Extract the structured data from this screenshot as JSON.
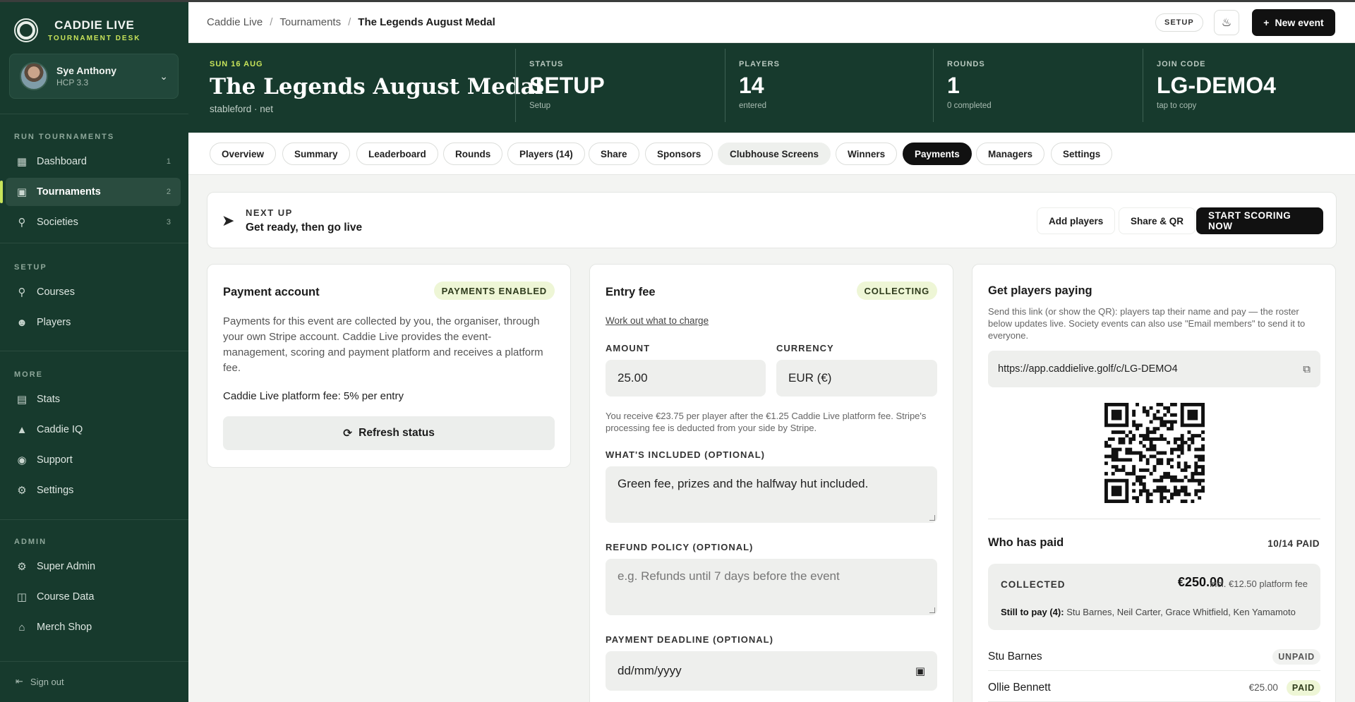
{
  "brand": {
    "name": "CADDIE LIVE",
    "tagline": "TOURNAMENT DESK"
  },
  "user": {
    "name": "Sye Anthony",
    "handicap": "HCP 3.3"
  },
  "sidebar": {
    "sections": [
      {
        "label": "RUN TOURNAMENTS",
        "items": [
          {
            "label": "Dashboard",
            "icon": "grid-icon",
            "count": "1"
          },
          {
            "label": "Tournaments",
            "icon": "calendar-icon",
            "count": "2",
            "active": true
          },
          {
            "label": "Societies",
            "icon": "trophy-icon",
            "count": "3"
          }
        ]
      },
      {
        "label": "SETUP",
        "items": [
          {
            "label": "Courses",
            "icon": "location-pin-icon"
          },
          {
            "label": "Players",
            "icon": "users-icon"
          }
        ]
      },
      {
        "label": "MORE",
        "items": [
          {
            "label": "Stats",
            "icon": "bar-chart-icon"
          },
          {
            "label": "Caddie IQ",
            "icon": "graduation-cap-icon"
          },
          {
            "label": "Support",
            "icon": "lifebuoy-icon"
          },
          {
            "label": "Settings",
            "icon": "gear-icon"
          }
        ]
      },
      {
        "label": "ADMIN",
        "items": [
          {
            "label": "Super Admin",
            "icon": "gear-icon"
          },
          {
            "label": "Course Data",
            "icon": "database-icon"
          },
          {
            "label": "Merch Shop",
            "icon": "store-icon"
          }
        ]
      }
    ],
    "signout": "Sign out"
  },
  "breadcrumb": {
    "root": "Caddie Live",
    "parent": "Tournaments",
    "current": "The Legends August Medal"
  },
  "header": {
    "status_pill": "SETUP",
    "new_event": "New event"
  },
  "hero": {
    "date": "SUN 16 AUG",
    "title": "The Legends August Medal",
    "format": "stableford · net",
    "stats": [
      {
        "label": "STATUS",
        "value": "SETUP",
        "sub": "Setup"
      },
      {
        "label": "PLAYERS",
        "value": "14",
        "sub": "entered"
      },
      {
        "label": "ROUNDS",
        "value": "1",
        "sub": "0 completed"
      },
      {
        "label": "JOIN CODE",
        "value": "LG-DEMO4",
        "sub": "tap to copy"
      }
    ]
  },
  "tabs": [
    "Overview",
    "Summary",
    "Leaderboard",
    "Rounds",
    "Players (14)",
    "Share",
    "Sponsors",
    "Clubhouse Screens",
    "Winners",
    "Payments",
    "Managers",
    "Settings"
  ],
  "active_tab": "Payments",
  "next_up": {
    "label": "NEXT UP",
    "text": "Get ready, then go live",
    "add_players": "Add players",
    "share_qr": "Share & QR",
    "start_scoring": "START SCORING NOW"
  },
  "payment_account": {
    "title": "Payment account",
    "badge": "PAYMENTS ENABLED",
    "description": "Payments for this event are collected by you, the organiser, through your own Stripe account. Caddie Live provides the event-management, scoring and payment platform and receives a platform fee.",
    "platform_fee": "Caddie Live platform fee: 5% per entry",
    "refresh": "Refresh status"
  },
  "entry_fee": {
    "title": "Entry fee",
    "badge": "COLLECTING",
    "work_out_link": "Work out what to charge",
    "amount_label": "AMOUNT",
    "amount_value": "25.00",
    "currency_label": "CURRENCY",
    "currency_value": "EUR (€)",
    "note": "You receive €23.75 per player after the €1.25 Caddie Live platform fee. Stripe's processing fee is deducted from your side by Stripe.",
    "included_label": "WHAT'S INCLUDED (OPTIONAL)",
    "included_value": "Green fee, prizes and the halfway hut included.",
    "refund_label": "REFUND POLICY (OPTIONAL)",
    "refund_placeholder": "e.g. Refunds until 7 days before the event",
    "deadline_label": "PAYMENT DEADLINE (OPTIONAL)",
    "deadline_placeholder": "dd/mm/yyyy"
  },
  "get_paying": {
    "title": "Get players paying",
    "description": "Send this link (or show the QR): players tap their name and pay — the roster below updates live. Society events can also use \"Email members\" to send it to everyone.",
    "link": "https://app.caddielive.golf/c/LG-DEMO4",
    "who_paid_title": "Who has paid",
    "paid_count": "10/14 PAID",
    "collected_label": "COLLECTED",
    "collected_amount": "€250.00",
    "collected_fee": "incl. €12.50 platform fee",
    "still_to_pay_label": "Still to pay (4):",
    "still_to_pay_names": "Stu Barnes, Neil Carter, Grace Whitfield, Ken Yamamoto",
    "roster": [
      {
        "name": "Stu Barnes",
        "amount": "",
        "status": "UNPAID"
      },
      {
        "name": "Ollie Bennett",
        "amount": "€25.00",
        "status": "PAID"
      }
    ]
  },
  "colors": {
    "sidebar_bg": "#173a2d",
    "accent_lime": "#c8e45a",
    "badge_bg": "#eef6d6"
  }
}
